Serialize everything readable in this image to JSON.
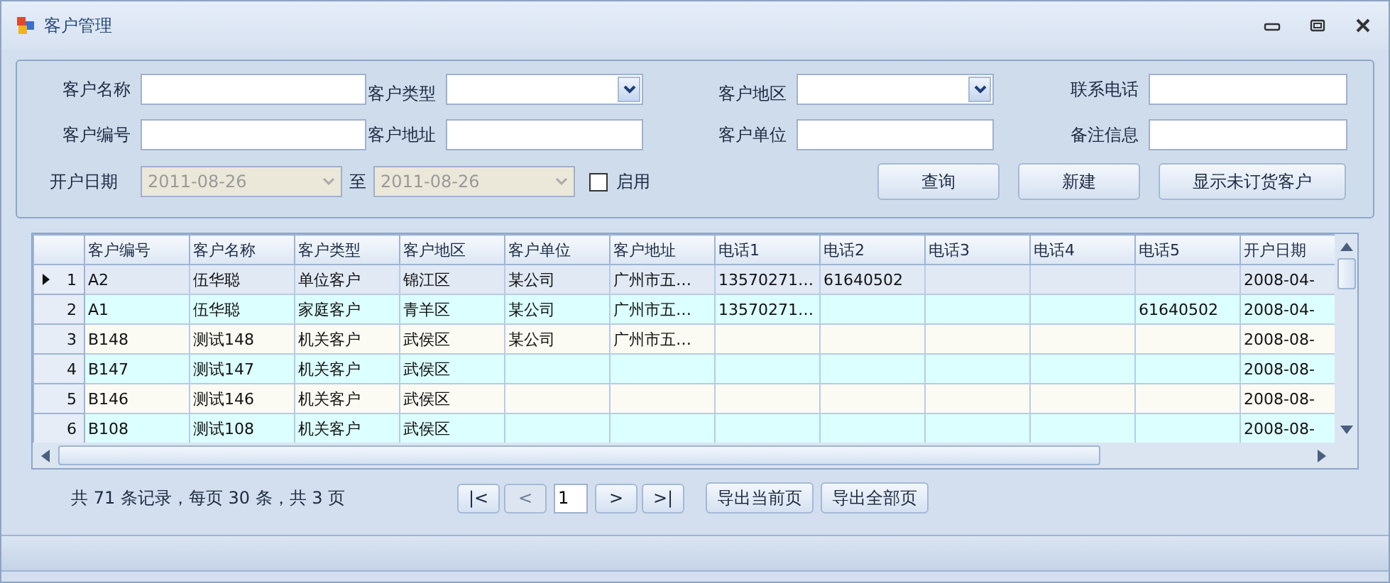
{
  "window": {
    "title": "客户管理"
  },
  "filters": {
    "fields": [
      {
        "label": "客户名称",
        "kind": "text"
      },
      {
        "label": "客户类型",
        "kind": "combo"
      },
      {
        "label": "客户地区",
        "kind": "combo"
      },
      {
        "label": "联系电话",
        "kind": "text"
      },
      {
        "label": "客户编号",
        "kind": "text"
      },
      {
        "label": "客户地址",
        "kind": "text"
      },
      {
        "label": "客户单位",
        "kind": "text"
      },
      {
        "label": "备注信息",
        "kind": "text"
      }
    ],
    "date_range": {
      "label": "开户日期",
      "from": {
        "value": "2011-08-26",
        "disabled": true
      },
      "separator": "至",
      "to": {
        "value": "2011-08-26",
        "disabled": true
      },
      "enable": {
        "label": "启用",
        "checked": false
      }
    },
    "buttons": [
      "查询",
      "新建",
      "显示未订货客户"
    ]
  },
  "table": {
    "columns": [
      "客户编号",
      "客户名称",
      "客户类型",
      "客户地区",
      "客户单位",
      "客户地址",
      "电话1",
      "电话2",
      "电话3",
      "电话4",
      "电话5",
      "开户日期"
    ],
    "rows": [
      {
        "number": "1",
        "selected": true,
        "cells": [
          "A2",
          "伍华聪",
          "单位客户",
          "锦江区",
          "某公司",
          "广州市五…",
          "13570271…",
          "61640502",
          null,
          null,
          null,
          "2008-04-"
        ]
      },
      {
        "number": "2",
        "selected": false,
        "cells": [
          "A1",
          "伍华聪",
          "家庭客户",
          "青羊区",
          "某公司",
          "广州市五…",
          "13570271…",
          null,
          null,
          null,
          "61640502",
          "2008-04-"
        ]
      },
      {
        "number": "3",
        "selected": false,
        "cells": [
          "B148",
          "测试148",
          "机关客户",
          "武侯区",
          "某公司",
          "广州市五…",
          null,
          null,
          null,
          null,
          null,
          "2008-08-"
        ]
      },
      {
        "number": "4",
        "selected": false,
        "cells": [
          "B147",
          "测试147",
          "机关客户",
          "武侯区",
          null,
          null,
          null,
          null,
          null,
          null,
          null,
          "2008-08-"
        ]
      },
      {
        "number": "5",
        "selected": false,
        "cells": [
          "B146",
          "测试146",
          "机关客户",
          "武侯区",
          null,
          null,
          null,
          null,
          null,
          null,
          null,
          "2008-08-"
        ]
      },
      {
        "number": "6",
        "selected": false,
        "cells": [
          "B108",
          "测试108",
          "机关客户",
          "武侯区",
          null,
          null,
          null,
          null,
          null,
          null,
          null,
          "2008-08-"
        ]
      }
    ]
  },
  "pager": {
    "summary": "共 71 条记录，每页 30 条，共 3 页",
    "back_buttons": [
      {
        "label": "|<",
        "disabled": false
      },
      {
        "label": "<",
        "disabled": true
      }
    ],
    "page": "1",
    "forward_buttons": [
      {
        "label": ">",
        "disabled": false
      },
      {
        "label": ">|",
        "disabled": false
      }
    ],
    "export_buttons": [
      "导出当前页",
      "导出全部页"
    ]
  }
}
